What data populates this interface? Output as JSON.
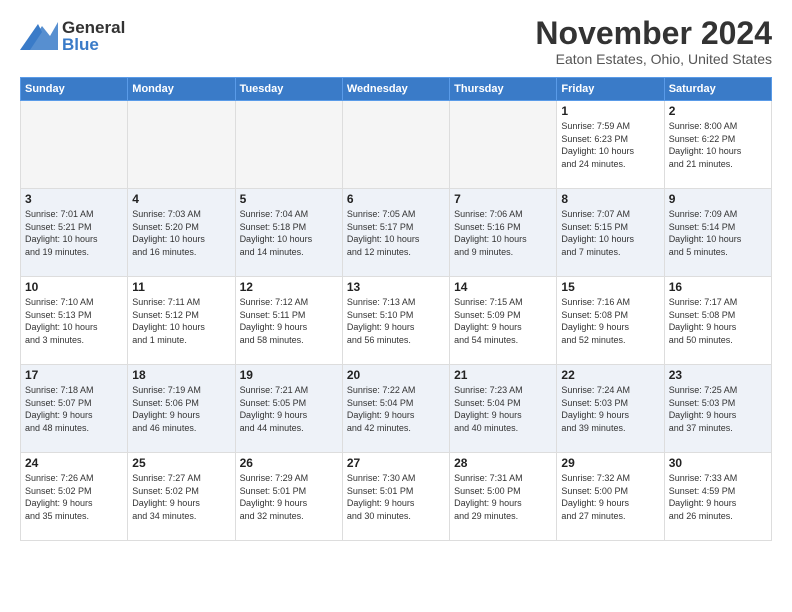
{
  "header": {
    "logo": {
      "general": "General",
      "blue": "Blue"
    },
    "title": "November 2024",
    "location": "Eaton Estates, Ohio, United States"
  },
  "days_of_week": [
    "Sunday",
    "Monday",
    "Tuesday",
    "Wednesday",
    "Thursday",
    "Friday",
    "Saturday"
  ],
  "weeks": [
    [
      {
        "day": "",
        "info": ""
      },
      {
        "day": "",
        "info": ""
      },
      {
        "day": "",
        "info": ""
      },
      {
        "day": "",
        "info": ""
      },
      {
        "day": "",
        "info": ""
      },
      {
        "day": "1",
        "info": "Sunrise: 7:59 AM\nSunset: 6:23 PM\nDaylight: 10 hours\nand 24 minutes."
      },
      {
        "day": "2",
        "info": "Sunrise: 8:00 AM\nSunset: 6:22 PM\nDaylight: 10 hours\nand 21 minutes."
      }
    ],
    [
      {
        "day": "3",
        "info": "Sunrise: 7:01 AM\nSunset: 5:21 PM\nDaylight: 10 hours\nand 19 minutes."
      },
      {
        "day": "4",
        "info": "Sunrise: 7:03 AM\nSunset: 5:20 PM\nDaylight: 10 hours\nand 16 minutes."
      },
      {
        "day": "5",
        "info": "Sunrise: 7:04 AM\nSunset: 5:18 PM\nDaylight: 10 hours\nand 14 minutes."
      },
      {
        "day": "6",
        "info": "Sunrise: 7:05 AM\nSunset: 5:17 PM\nDaylight: 10 hours\nand 12 minutes."
      },
      {
        "day": "7",
        "info": "Sunrise: 7:06 AM\nSunset: 5:16 PM\nDaylight: 10 hours\nand 9 minutes."
      },
      {
        "day": "8",
        "info": "Sunrise: 7:07 AM\nSunset: 5:15 PM\nDaylight: 10 hours\nand 7 minutes."
      },
      {
        "day": "9",
        "info": "Sunrise: 7:09 AM\nSunset: 5:14 PM\nDaylight: 10 hours\nand 5 minutes."
      }
    ],
    [
      {
        "day": "10",
        "info": "Sunrise: 7:10 AM\nSunset: 5:13 PM\nDaylight: 10 hours\nand 3 minutes."
      },
      {
        "day": "11",
        "info": "Sunrise: 7:11 AM\nSunset: 5:12 PM\nDaylight: 10 hours\nand 1 minute."
      },
      {
        "day": "12",
        "info": "Sunrise: 7:12 AM\nSunset: 5:11 PM\nDaylight: 9 hours\nand 58 minutes."
      },
      {
        "day": "13",
        "info": "Sunrise: 7:13 AM\nSunset: 5:10 PM\nDaylight: 9 hours\nand 56 minutes."
      },
      {
        "day": "14",
        "info": "Sunrise: 7:15 AM\nSunset: 5:09 PM\nDaylight: 9 hours\nand 54 minutes."
      },
      {
        "day": "15",
        "info": "Sunrise: 7:16 AM\nSunset: 5:08 PM\nDaylight: 9 hours\nand 52 minutes."
      },
      {
        "day": "16",
        "info": "Sunrise: 7:17 AM\nSunset: 5:08 PM\nDaylight: 9 hours\nand 50 minutes."
      }
    ],
    [
      {
        "day": "17",
        "info": "Sunrise: 7:18 AM\nSunset: 5:07 PM\nDaylight: 9 hours\nand 48 minutes."
      },
      {
        "day": "18",
        "info": "Sunrise: 7:19 AM\nSunset: 5:06 PM\nDaylight: 9 hours\nand 46 minutes."
      },
      {
        "day": "19",
        "info": "Sunrise: 7:21 AM\nSunset: 5:05 PM\nDaylight: 9 hours\nand 44 minutes."
      },
      {
        "day": "20",
        "info": "Sunrise: 7:22 AM\nSunset: 5:04 PM\nDaylight: 9 hours\nand 42 minutes."
      },
      {
        "day": "21",
        "info": "Sunrise: 7:23 AM\nSunset: 5:04 PM\nDaylight: 9 hours\nand 40 minutes."
      },
      {
        "day": "22",
        "info": "Sunrise: 7:24 AM\nSunset: 5:03 PM\nDaylight: 9 hours\nand 39 minutes."
      },
      {
        "day": "23",
        "info": "Sunrise: 7:25 AM\nSunset: 5:03 PM\nDaylight: 9 hours\nand 37 minutes."
      }
    ],
    [
      {
        "day": "24",
        "info": "Sunrise: 7:26 AM\nSunset: 5:02 PM\nDaylight: 9 hours\nand 35 minutes."
      },
      {
        "day": "25",
        "info": "Sunrise: 7:27 AM\nSunset: 5:02 PM\nDaylight: 9 hours\nand 34 minutes."
      },
      {
        "day": "26",
        "info": "Sunrise: 7:29 AM\nSunset: 5:01 PM\nDaylight: 9 hours\nand 32 minutes."
      },
      {
        "day": "27",
        "info": "Sunrise: 7:30 AM\nSunset: 5:01 PM\nDaylight: 9 hours\nand 30 minutes."
      },
      {
        "day": "28",
        "info": "Sunrise: 7:31 AM\nSunset: 5:00 PM\nDaylight: 9 hours\nand 29 minutes."
      },
      {
        "day": "29",
        "info": "Sunrise: 7:32 AM\nSunset: 5:00 PM\nDaylight: 9 hours\nand 27 minutes."
      },
      {
        "day": "30",
        "info": "Sunrise: 7:33 AM\nSunset: 4:59 PM\nDaylight: 9 hours\nand 26 minutes."
      }
    ]
  ]
}
